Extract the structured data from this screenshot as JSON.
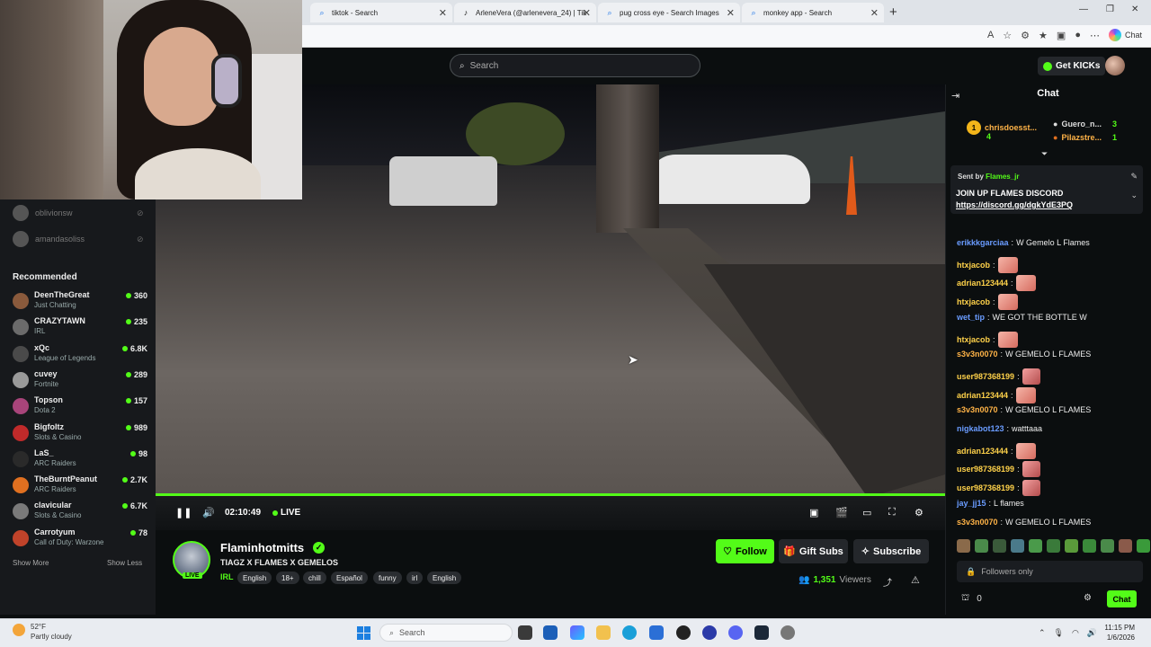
{
  "browser": {
    "tabs": [
      {
        "label": "tiktok - Search",
        "icon": "search-icon"
      },
      {
        "label": "ArleneVera (@arlenevera_24) | Tik",
        "icon": "tiktok-icon"
      },
      {
        "label": "pug cross eye - Search Images",
        "icon": "search-icon"
      },
      {
        "label": "monkey app - Search",
        "icon": "search-icon"
      }
    ],
    "chat_button": "Chat"
  },
  "header": {
    "search_placeholder": "Search",
    "get_kicks": "Get KICKs"
  },
  "sidebar": {
    "offline": [
      {
        "name": "oblivionsw"
      },
      {
        "name": "amandasoliss"
      }
    ],
    "recommended_title": "Recommended",
    "recommended": [
      {
        "name": "DeenTheGreat",
        "category": "Just Chatting",
        "viewers": "360",
        "color": "#8a5a3c"
      },
      {
        "name": "CRAZYTAWN",
        "category": "IRL",
        "viewers": "235",
        "color": "#6b6b6b"
      },
      {
        "name": "xQc",
        "category": "League of Legends",
        "viewers": "6.8K",
        "color": "#4a4a4a"
      },
      {
        "name": "cuvey",
        "category": "Fortnite",
        "viewers": "289",
        "color": "#9a9a9a"
      },
      {
        "name": "Topson",
        "category": "Dota 2",
        "viewers": "157",
        "color": "#a8447a"
      },
      {
        "name": "Bigfoltz",
        "category": "Slots & Casino",
        "viewers": "989",
        "color": "#c02a2a"
      },
      {
        "name": "LaS_",
        "category": "ARC Raiders",
        "viewers": "98",
        "color": "#2a2a2a"
      },
      {
        "name": "TheBurntPeanut",
        "category": "ARC Raiders",
        "viewers": "2.7K",
        "color": "#e07020"
      },
      {
        "name": "clavicular",
        "category": "Slots & Casino",
        "viewers": "6.7K",
        "color": "#7a7a7a"
      },
      {
        "name": "Carrotyum",
        "category": "Call of Duty: Warzone",
        "viewers": "78",
        "color": "#c0432a"
      }
    ],
    "show_more": "Show More",
    "show_less": "Show Less"
  },
  "player": {
    "time": "02:10:49",
    "live": "LIVE",
    "progress": 1.0
  },
  "channel": {
    "name": "Flaminhotmitts",
    "live_badge": "LIVE",
    "title": "TIAGZ X FLAMES X GEMELOS",
    "category": "IRL",
    "tags": [
      "English",
      "18+",
      "chill",
      "Español",
      "funny",
      "irl",
      "English"
    ],
    "follow": "Follow",
    "gift_subs": "Gift Subs",
    "subscribe": "Subscribe",
    "viewers_count": "1,351",
    "viewers_label": "Viewers"
  },
  "chat": {
    "title": "Chat",
    "leaderboard": [
      {
        "rank": "1",
        "name": "chrisdoesst...",
        "count": "4"
      },
      {
        "name": "Guero_n...",
        "count": "3"
      },
      {
        "name": "Pilazstre...",
        "count": "1"
      }
    ],
    "pinned": {
      "sent_by_label": "Sent by",
      "sent_by_user": "Flames_jr",
      "line1": "JOIN UP FLAMES DISCORD",
      "link": "https://discord.gg/dgkYdE3PQ"
    },
    "messages": [
      {
        "user": "erikkkgarciaa",
        "text": "W Gemelo L Flames",
        "color": "#6a9cff"
      },
      {
        "user": "htxjacob",
        "text": "",
        "color": "#ffd24a",
        "emote": "hand"
      },
      {
        "user": "adrian123444",
        "text": "",
        "color": "#ffd24a",
        "emote": "hand"
      },
      {
        "user": "htxjacob",
        "text": "",
        "color": "#ffd24a",
        "emote": "hand"
      },
      {
        "user": "wet_tip",
        "text": "WE GOT THE BOTTLE W",
        "color": "#6a9cff"
      },
      {
        "user": "htxjacob",
        "text": "",
        "color": "#ffd24a",
        "emote": "hand"
      },
      {
        "user": "s3v3n0070",
        "text": "W GEMELO L FLAMES",
        "color": "#ffb347"
      },
      {
        "user": "user987368199",
        "text": "",
        "color": "#ffd24a",
        "emote": "face"
      },
      {
        "user": "adrian123444",
        "text": "",
        "color": "#ffd24a",
        "emote": "hand"
      },
      {
        "user": "s3v3n0070",
        "text": "W GEMELO L FLAMES",
        "color": "#ffb347"
      },
      {
        "user": "nigkabot123",
        "text": "watttaaa",
        "color": "#6a9cff"
      },
      {
        "user": "adrian123444",
        "text": "",
        "color": "#ffd24a",
        "emote": "hand"
      },
      {
        "user": "user987368199",
        "text": "",
        "color": "#ffd24a",
        "emote": "face"
      },
      {
        "user": "user987368199",
        "text": "",
        "color": "#ffd24a",
        "emote": "face"
      },
      {
        "user": "jay_jj15",
        "text": "L flames",
        "color": "#6a9cff"
      },
      {
        "user": "s3v3n0070",
        "text": "W GEMELO L FLAMES",
        "color": "#ffb347"
      }
    ],
    "input_placeholder": "Followers only",
    "kicks_count": "0",
    "send": "Chat"
  },
  "taskbar": {
    "temp": "52°F",
    "weather": "Partly cloudy",
    "search": "Search",
    "time": "11:15 PM",
    "date": "1/6/2026"
  },
  "colors": {
    "accent": "#53fc18",
    "bg": "#0b0e0f"
  }
}
